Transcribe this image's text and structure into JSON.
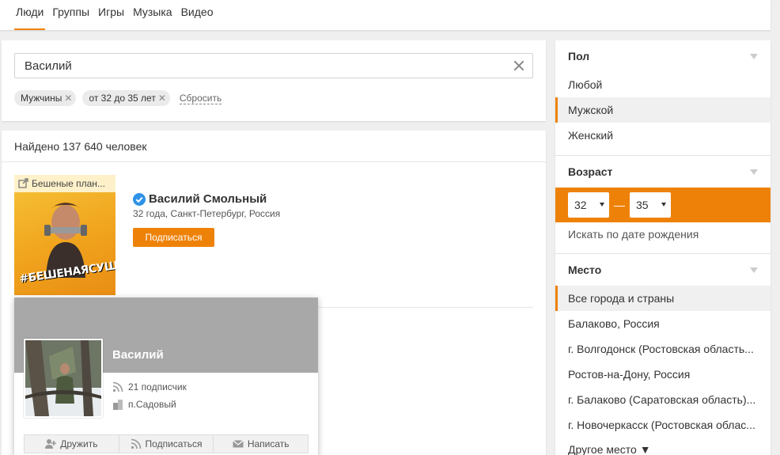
{
  "tabs": [
    "Люди",
    "Группы",
    "Игры",
    "Музыка",
    "Видео"
  ],
  "active_tab": 0,
  "search": {
    "value": "Василий",
    "chips": [
      "Мужчины",
      "от 32 до 35 лет"
    ],
    "reset_label": "Сбросить"
  },
  "results": {
    "count_text": "Найдено 137 640 человек",
    "item": {
      "thumb_title": "Бешеные план...",
      "thumb_caption": "#БЕШЕНАЯСУШКА",
      "name": "Василий Смольный",
      "meta": "32 года, Санкт-Петербург, Россия",
      "subscribe_label": "Подписаться"
    }
  },
  "popup": {
    "name": "Василий",
    "subscribers": "21 подписчик",
    "location": "п.Садовый",
    "actions": [
      "Дружить",
      "Подписаться",
      "Написать"
    ]
  },
  "sidebar": {
    "gender": {
      "title": "Пол",
      "options": [
        "Любой",
        "Мужской",
        "Женский"
      ],
      "selected": 1
    },
    "age": {
      "title": "Возраст",
      "from": "32",
      "to": "35",
      "dash": "—",
      "birth_link": "Искать по дате рождения"
    },
    "place": {
      "title": "Место",
      "options": [
        "Все города и страны",
        "Балаково, Россия",
        "г. Волгодонск (Ростовская область...",
        "Ростов-на-Дону, Россия",
        "г. Балаково (Саратовская область)...",
        "г. Новочеркасск (Ростовская облас..."
      ],
      "selected": 0,
      "more": "Другое место ▼"
    }
  },
  "colors": {
    "accent": "#ee8208",
    "verified": "#2f93e8"
  }
}
